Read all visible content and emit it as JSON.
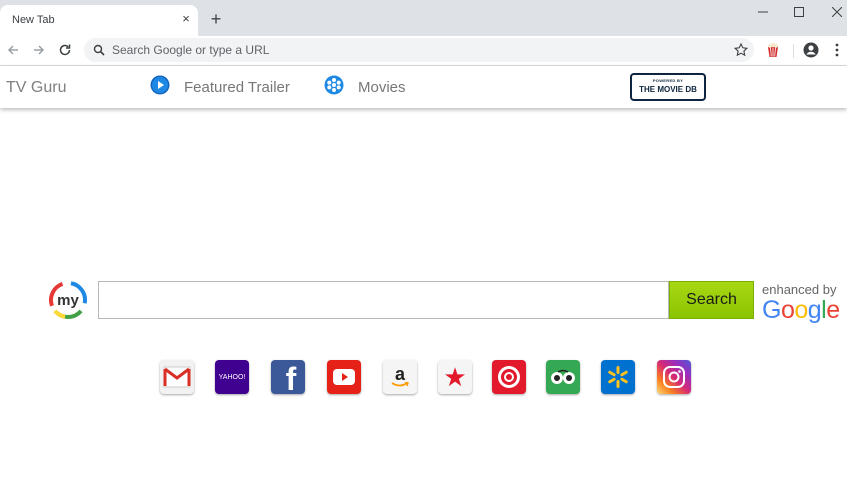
{
  "browser": {
    "tab_title": "New Tab",
    "tab_close": "×",
    "new_tab": "+",
    "omnibox_placeholder": "Search Google or type a URL"
  },
  "extension_bar": {
    "brand": "TV Guru",
    "links": [
      {
        "label": "Featured Trailer",
        "icon": "play-icon"
      },
      {
        "label": "Movies",
        "icon": "film-reel-icon"
      }
    ],
    "partner_logo": {
      "small": "POWERED BY",
      "big": "THE MOVIE DB"
    }
  },
  "search": {
    "logo_text": "my",
    "input_value": "",
    "button_label": "Search",
    "enhanced_by": "enhanced by",
    "google": [
      "G",
      "o",
      "o",
      "g",
      "l",
      "e"
    ],
    "google_colors": [
      "#4285f4",
      "#ea4335",
      "#fbbc05",
      "#4285f4",
      "#34a853",
      "#ea4335"
    ]
  },
  "quick_links": [
    {
      "name": "gmail",
      "text": ""
    },
    {
      "name": "yahoo",
      "text": "YAHOO!"
    },
    {
      "name": "facebook",
      "text": "f"
    },
    {
      "name": "youtube",
      "text": ""
    },
    {
      "name": "amazon",
      "text": "a"
    },
    {
      "name": "macys",
      "text": "★"
    },
    {
      "name": "target",
      "text": ""
    },
    {
      "name": "tripadvisor",
      "text": ""
    },
    {
      "name": "walmart",
      "text": ""
    },
    {
      "name": "instagram",
      "text": ""
    }
  ],
  "colors": {
    "accent_green": "#95cc00",
    "tab_strip": "#dee1e6"
  }
}
